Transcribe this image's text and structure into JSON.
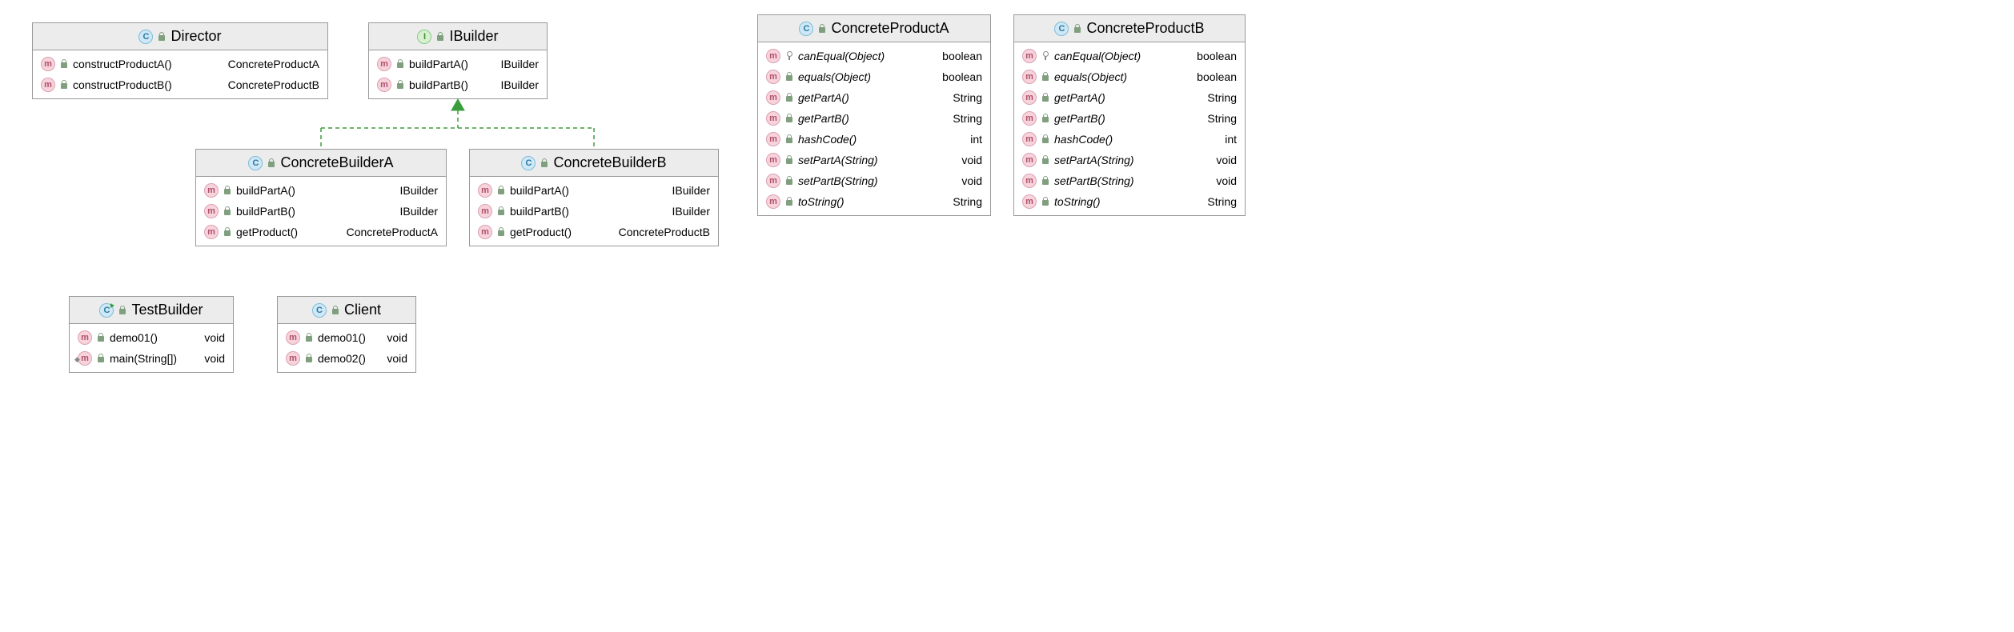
{
  "diagram_type": "UML Class Diagram",
  "classes": {
    "director": {
      "name": "Director",
      "kind": "class",
      "members": [
        {
          "name": "constructProductA()",
          "ret": "ConcreteProductA",
          "vis": "lock"
        },
        {
          "name": "constructProductB()",
          "ret": "ConcreteProductB",
          "vis": "lock"
        }
      ]
    },
    "ibuilder": {
      "name": "IBuilder",
      "kind": "interface",
      "members": [
        {
          "name": "buildPartA()",
          "ret": "IBuilder",
          "vis": "lock"
        },
        {
          "name": "buildPartB()",
          "ret": "IBuilder",
          "vis": "lock"
        }
      ]
    },
    "concretebuildera": {
      "name": "ConcreteBuilderA",
      "kind": "class",
      "members": [
        {
          "name": "buildPartA()",
          "ret": "IBuilder",
          "vis": "lock"
        },
        {
          "name": "buildPartB()",
          "ret": "IBuilder",
          "vis": "lock"
        },
        {
          "name": "getProduct()",
          "ret": "ConcreteProductA",
          "vis": "lock"
        }
      ]
    },
    "concretebuilderb": {
      "name": "ConcreteBuilderB",
      "kind": "class",
      "members": [
        {
          "name": "buildPartA()",
          "ret": "IBuilder",
          "vis": "lock"
        },
        {
          "name": "buildPartB()",
          "ret": "IBuilder",
          "vis": "lock"
        },
        {
          "name": "getProduct()",
          "ret": "ConcreteProductB",
          "vis": "lock"
        }
      ]
    },
    "concreteproducta": {
      "name": "ConcreteProductA",
      "kind": "class",
      "members": [
        {
          "name": "canEqual(Object)",
          "ret": "boolean",
          "vis": "key",
          "italic": true
        },
        {
          "name": "equals(Object)",
          "ret": "boolean",
          "vis": "lock",
          "italic": true
        },
        {
          "name": "getPartA()",
          "ret": "String",
          "vis": "lock",
          "italic": true
        },
        {
          "name": "getPartB()",
          "ret": "String",
          "vis": "lock",
          "italic": true
        },
        {
          "name": "hashCode()",
          "ret": "int",
          "vis": "lock",
          "italic": true
        },
        {
          "name": "setPartA(String)",
          "ret": "void",
          "vis": "lock",
          "italic": true
        },
        {
          "name": "setPartB(String)",
          "ret": "void",
          "vis": "lock",
          "italic": true
        },
        {
          "name": "toString()",
          "ret": "String",
          "vis": "lock",
          "italic": true
        }
      ]
    },
    "concreteproductb": {
      "name": "ConcreteProductB",
      "kind": "class",
      "members": [
        {
          "name": "canEqual(Object)",
          "ret": "boolean",
          "vis": "key",
          "italic": true
        },
        {
          "name": "equals(Object)",
          "ret": "boolean",
          "vis": "lock",
          "italic": true
        },
        {
          "name": "getPartA()",
          "ret": "String",
          "vis": "lock",
          "italic": true
        },
        {
          "name": "getPartB()",
          "ret": "String",
          "vis": "lock",
          "italic": true
        },
        {
          "name": "hashCode()",
          "ret": "int",
          "vis": "lock",
          "italic": true
        },
        {
          "name": "setPartA(String)",
          "ret": "void",
          "vis": "lock",
          "italic": true
        },
        {
          "name": "setPartB(String)",
          "ret": "void",
          "vis": "lock",
          "italic": true
        },
        {
          "name": "toString()",
          "ret": "String",
          "vis": "lock",
          "italic": true
        }
      ]
    },
    "testbuilder": {
      "name": "TestBuilder",
      "kind": "runnable-class",
      "members": [
        {
          "name": "demo01()",
          "ret": "void",
          "vis": "lock"
        },
        {
          "name": "main(String[])",
          "ret": "void",
          "vis": "lock",
          "static": true
        }
      ]
    },
    "client": {
      "name": "Client",
      "kind": "class",
      "members": [
        {
          "name": "demo01()",
          "ret": "void",
          "vis": "lock"
        },
        {
          "name": "demo02()",
          "ret": "void",
          "vis": "lock"
        }
      ]
    }
  },
  "relationships": [
    {
      "from": "ConcreteBuilderA",
      "to": "IBuilder",
      "type": "realization"
    },
    {
      "from": "ConcreteBuilderB",
      "to": "IBuilder",
      "type": "realization"
    }
  ]
}
